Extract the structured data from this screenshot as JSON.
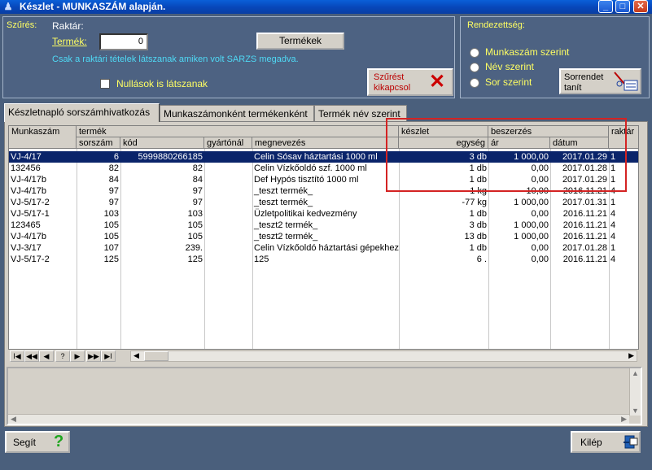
{
  "window": {
    "title": "Készlet - MUNKASZÁM alapján.",
    "minimize": "_",
    "maximize": "□",
    "close": "✕"
  },
  "filter": {
    "caption": "Szűrés:",
    "raktar_label": "Raktár:",
    "termek_label": "Termék:",
    "termek_value": "0",
    "termekek_button": "Termékek",
    "info": "Csak a raktári tételek látszanak amiken volt SARZS megadva.",
    "nullasok_label": "Nullások is látszanak",
    "szures_off_button": "Szűrést kikapcsol"
  },
  "sort": {
    "caption": "Rendezettség:",
    "options": [
      "Munkaszám szerint",
      "Név szerint",
      "Sor szerint"
    ],
    "sorrend_button": "Sorrendet tanít"
  },
  "tabs": [
    "Készletnapló sorszámhivatkozás",
    "Munkaszámonként termékenként",
    "Termék név szerint"
  ],
  "grid": {
    "group_headers": {
      "munkaszam": "Munkaszám",
      "termek": "termék",
      "keszlet": "készlet",
      "beszerzes": "beszerzés",
      "raktar": "raktár"
    },
    "sub_headers": {
      "sorszam": "sorszám",
      "kod": "kód",
      "gyartonal": "gyártónál",
      "megnevezes": "megnevezés",
      "egyseg": "egység",
      "ar": "ár",
      "datum": "dátum"
    },
    "rows": [
      {
        "munkaszam": "VJ-4/17",
        "sorszam": "6",
        "kod": "5999880266185",
        "gyartonal": "",
        "megnevezes": "Celin Sósav háztartási 1000 ml",
        "keszlet": "3 db",
        "ar": "1 000,00",
        "datum": "2017.01.29",
        "raktar": "1"
      },
      {
        "munkaszam": "132456",
        "sorszam": "82",
        "kod": "82",
        "gyartonal": "",
        "megnevezes": "Celin Vízkőoldó szf. 1000 ml",
        "keszlet": "1 db",
        "ar": "0,00",
        "datum": "2017.01.28",
        "raktar": "1"
      },
      {
        "munkaszam": "VJ-4/17b",
        "sorszam": "84",
        "kod": "84",
        "gyartonal": "",
        "megnevezes": "Def Hypós tisztító 1000 ml",
        "keszlet": "1 db",
        "ar": "0,00",
        "datum": "2017.01.29",
        "raktar": "1"
      },
      {
        "munkaszam": "VJ-4/17b",
        "sorszam": "97",
        "kod": "97",
        "gyartonal": "",
        "megnevezes": "_teszt termék_",
        "keszlet": "1 kg",
        "ar": "10,00",
        "datum": "2016.11.21",
        "raktar": "4"
      },
      {
        "munkaszam": "VJ-5/17-2",
        "sorszam": "97",
        "kod": "97",
        "gyartonal": "",
        "megnevezes": "_teszt termék_",
        "keszlet": "-77 kg",
        "ar": "1 000,00",
        "datum": "2017.01.31",
        "raktar": "1"
      },
      {
        "munkaszam": "VJ-5/17-1",
        "sorszam": "103",
        "kod": "103",
        "gyartonal": "",
        "megnevezes": "Üzletpolitikai kedvezmény",
        "keszlet": "1 db",
        "ar": "0,00",
        "datum": "2016.11.21",
        "raktar": "4"
      },
      {
        "munkaszam": "123465",
        "sorszam": "105",
        "kod": "105",
        "gyartonal": "",
        "megnevezes": "_teszt2 termék_",
        "keszlet": "3 db",
        "ar": "1 000,00",
        "datum": "2016.11.21",
        "raktar": "4"
      },
      {
        "munkaszam": "VJ-4/17b",
        "sorszam": "105",
        "kod": "105",
        "gyartonal": "",
        "megnevezes": "_teszt2 termék_",
        "keszlet": "13 db",
        "ar": "1 000,00",
        "datum": "2016.11.21",
        "raktar": "4"
      },
      {
        "munkaszam": "VJ-3/17",
        "sorszam": "107",
        "kod": "239.",
        "gyartonal": "",
        "megnevezes": "Celin Vízkőoldó háztartási gépekhez",
        "keszlet": "1 db",
        "ar": "0,00",
        "datum": "2017.01.28",
        "raktar": "1"
      },
      {
        "munkaszam": "VJ-5/17-2",
        "sorszam": "125",
        "kod": "125",
        "gyartonal": "",
        "megnevezes": "125",
        "keszlet": "6 .",
        "ar": "0,00",
        "datum": "2016.11.21",
        "raktar": "4"
      }
    ]
  },
  "nav": {
    "first": "I◀",
    "prev_page": "◀◀",
    "prev": "◀",
    "help": "?",
    "next": "▶",
    "next_page": "▶▶",
    "last": "▶I"
  },
  "bottom": {
    "help_button": "Segít",
    "help_icon": "?",
    "exit_button": "Kilép"
  },
  "colors": {
    "selection": "#0a246a",
    "panel": "#4d6282",
    "label_yellow": "#ffff63",
    "highlight_box": "#d42323"
  }
}
